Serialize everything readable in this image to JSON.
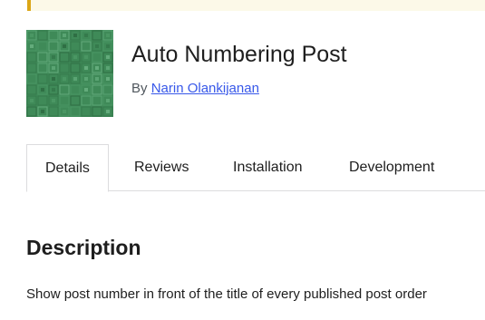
{
  "plugin": {
    "title": "Auto Numbering Post",
    "by_prefix": "By ",
    "author": "Narin Olankijanan",
    "icon_name": "plugin-pattern-icon",
    "icon_color": "#3f8a58"
  },
  "tabs": [
    {
      "label": "Details",
      "active": true
    },
    {
      "label": "Reviews",
      "active": false
    },
    {
      "label": "Installation",
      "active": false
    },
    {
      "label": "Development",
      "active": false
    }
  ],
  "description": {
    "heading": "Description",
    "text": "Show post number in front of the title of every published post order"
  },
  "colors": {
    "link": "#3858e9",
    "notice_border": "#dba617",
    "notice_bg": "#fcf9e8"
  }
}
